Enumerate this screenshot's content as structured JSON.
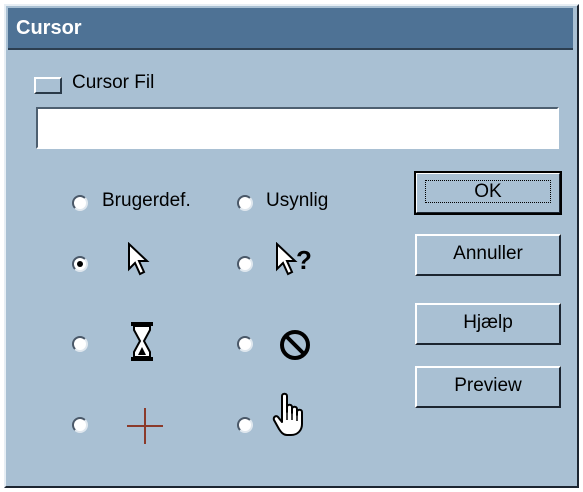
{
  "dialog": {
    "title": "Cursor"
  },
  "file": {
    "label": "Cursor Fil",
    "value": ""
  },
  "options": {
    "custom_label": "Brugerdef.",
    "hidden_label": "Usynlig",
    "selected": "arrow",
    "icons": [
      "arrow-cursor-icon",
      "help-cursor-icon",
      "hourglass-cursor-icon",
      "no-cursor-icon",
      "crosshair-cursor-icon",
      "hand-cursor-icon"
    ]
  },
  "buttons": {
    "ok": "OK",
    "cancel": "Annuller",
    "help": "Hjælp",
    "preview": "Preview"
  },
  "colors": {
    "title_bar": "#4e7295",
    "dialog_bg": "#a9c0d3",
    "crosshair": "#8b3a2a"
  }
}
